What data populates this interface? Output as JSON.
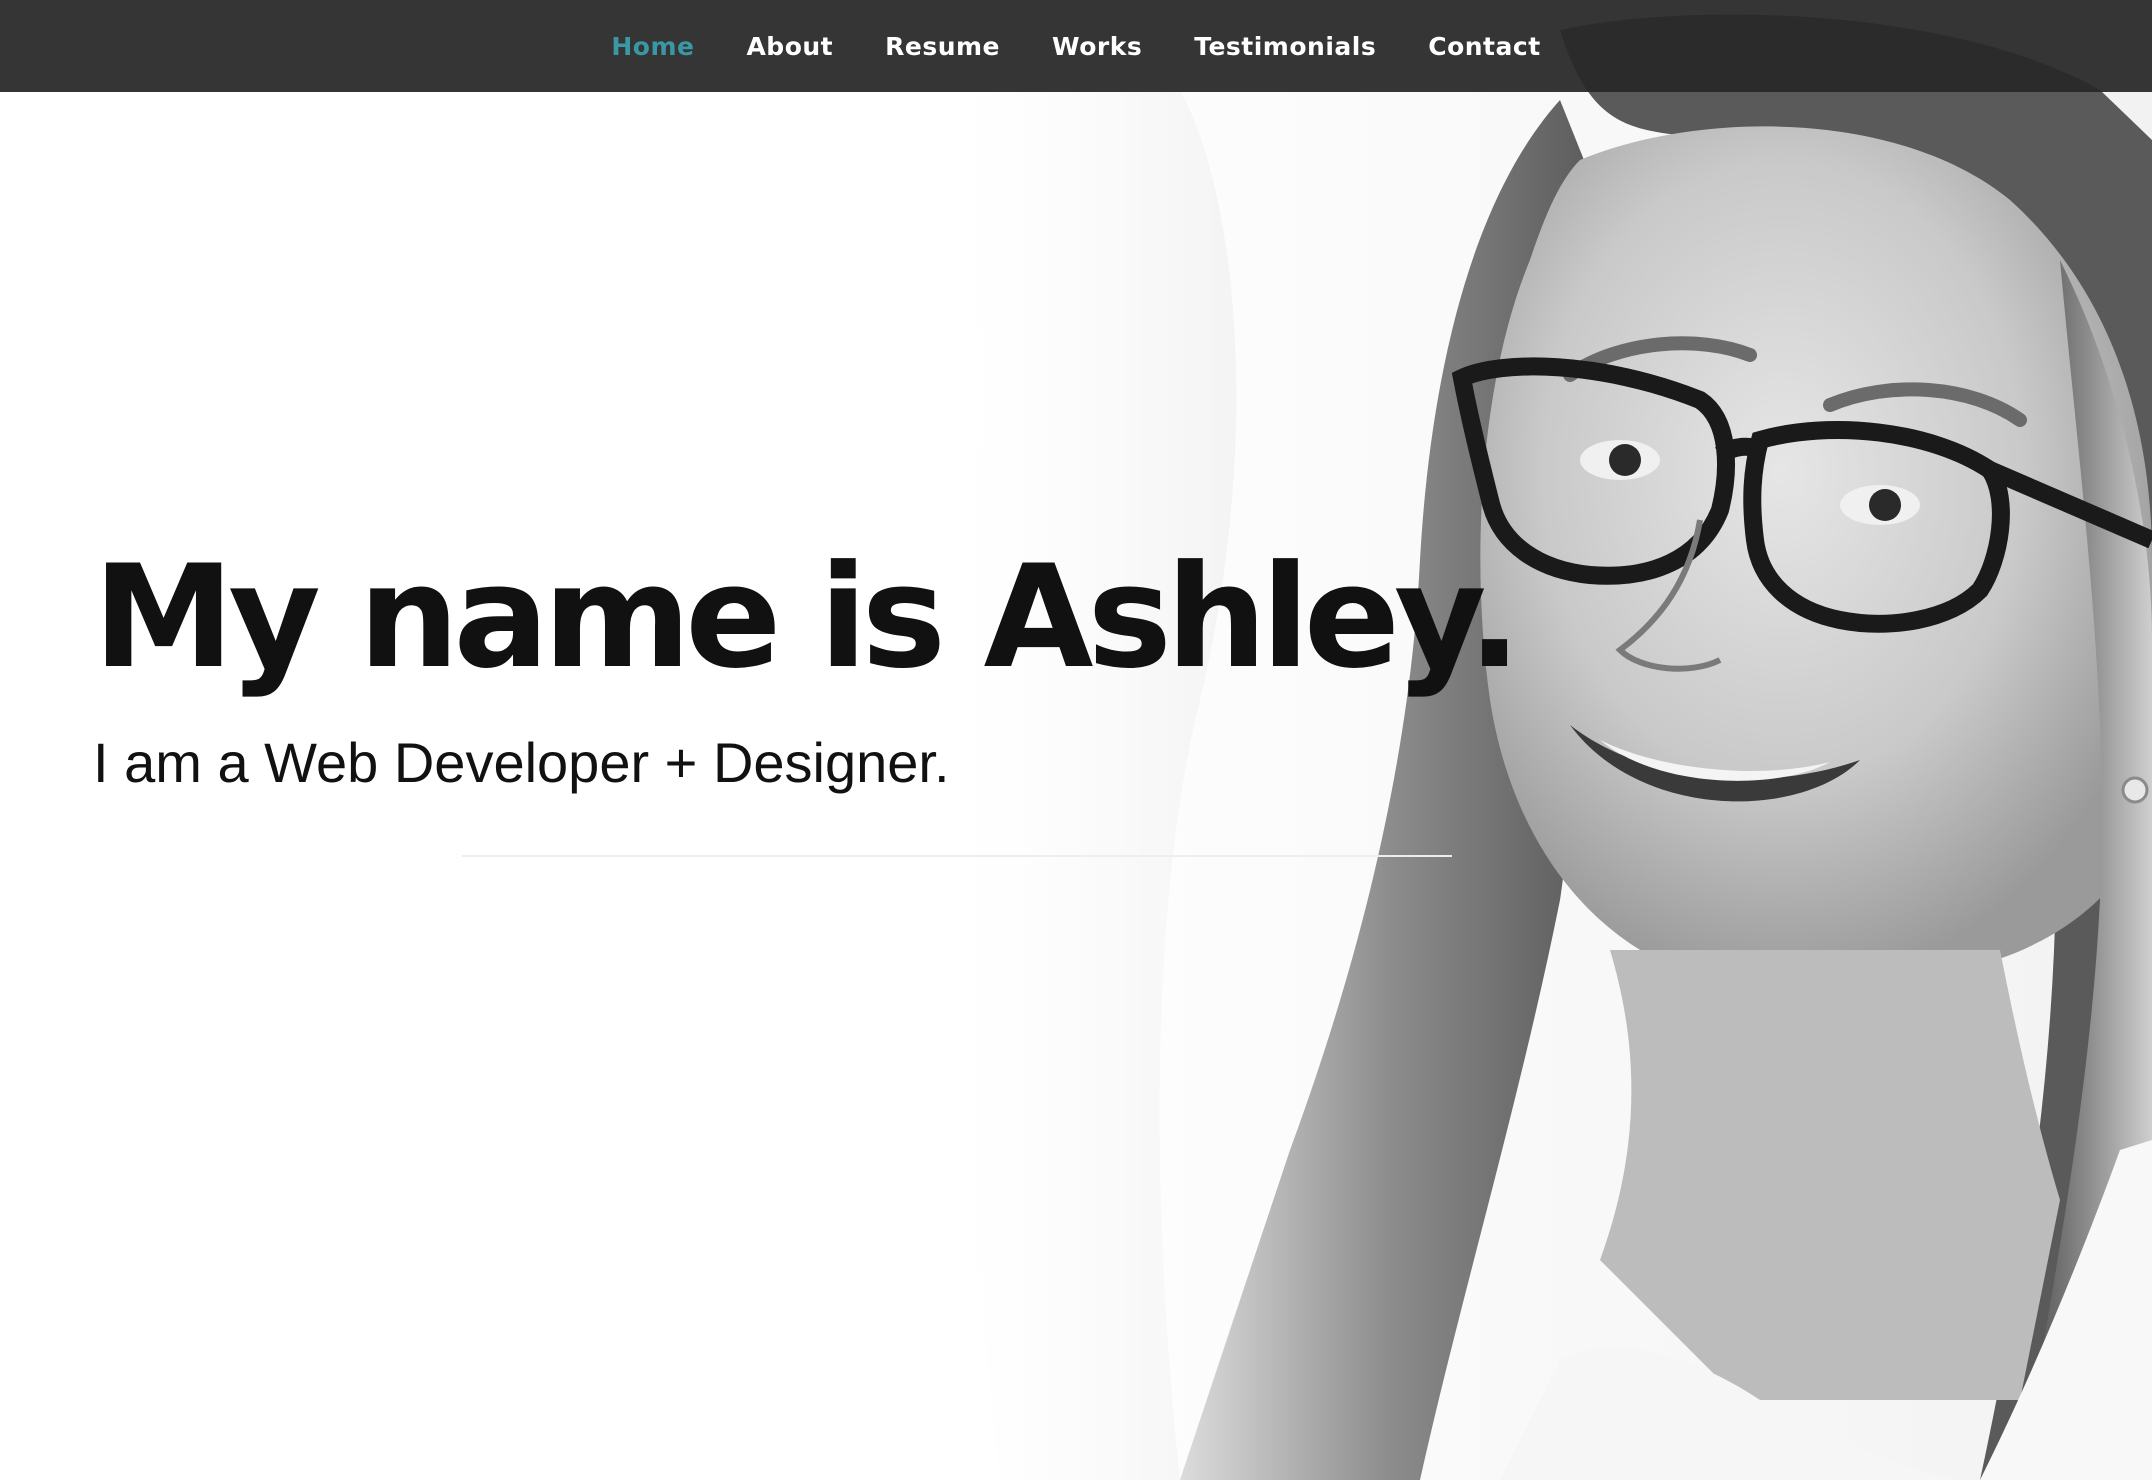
{
  "nav": {
    "items": [
      {
        "label": "Home",
        "active": true
      },
      {
        "label": "About",
        "active": false
      },
      {
        "label": "Resume",
        "active": false
      },
      {
        "label": "Works",
        "active": false
      },
      {
        "label": "Testimonials",
        "active": false
      },
      {
        "label": "Contact",
        "active": false
      }
    ],
    "active_color": "#3a97a4",
    "background_color": "#2d2d2d"
  },
  "hero": {
    "title": "My name is Ashley.",
    "subtitle": "I am a Web Developer + Designer.",
    "photo": "portrait-photo"
  }
}
